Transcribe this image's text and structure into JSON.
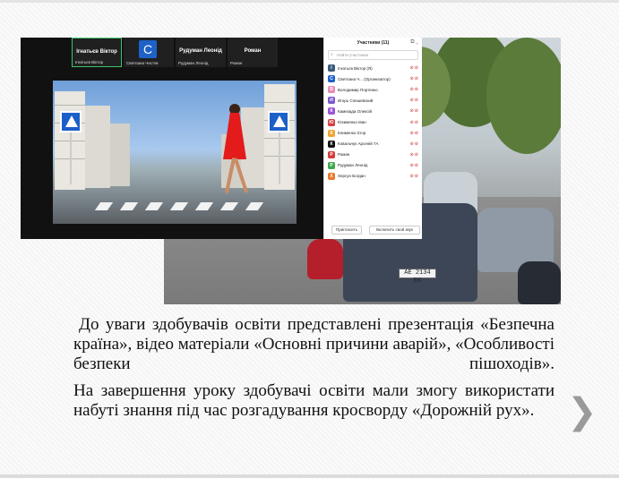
{
  "zoom": {
    "tiles": [
      {
        "name": "Ігнатьєв Віктор",
        "sub": "Ігнатьєв Віктор",
        "active": true
      },
      {
        "avatar": "C",
        "sub": "Светлана Чистяк"
      },
      {
        "name": "Рудуман Леонід",
        "sub": "Рудуман Леонід"
      },
      {
        "name": "Роман",
        "sub": "Роман"
      }
    ]
  },
  "participants": {
    "title": "Участники (11)",
    "search_placeholder": "Найти участника",
    "rows": [
      {
        "initial": "I",
        "color": "#3a5a7a",
        "name": "Ігнатьєв Віктор (Я)"
      },
      {
        "initial": "C",
        "color": "#1e62c8",
        "name": "Светлана Ч... (Организатор)"
      },
      {
        "initial": "В",
        "color": "#e98bb5",
        "name": "Володимир Портенко"
      },
      {
        "initial": "И",
        "color": "#7a56c9",
        "name": "Игорь Спешевский"
      },
      {
        "initial": "К",
        "color": "#9b55d8",
        "name": "Камизада Олексій"
      },
      {
        "initial": "Ю",
        "color": "#d63c3c",
        "name": "Юхименко Іван"
      },
      {
        "initial": "К",
        "color": "#f0a431",
        "name": "Клименко Єгор"
      },
      {
        "initial": "К",
        "color": "#111111",
        "name": "Ковальчук Арсеній 7А"
      },
      {
        "initial": "Р",
        "color": "#d63c3c",
        "name": "Роман"
      },
      {
        "initial": "Р",
        "color": "#3fa84b",
        "name": "Рудуман Леонід"
      },
      {
        "initial": "Х",
        "color": "#e8792a",
        "name": "Херсун Богдан"
      }
    ],
    "invite_label": "Пригласить",
    "unmute_label": "Включить свой звук"
  },
  "street": {
    "plate": "AE 2134 ЕК"
  },
  "body_text": {
    "paragraph1": "До уваги здобувачів освіти представлені презентація «Безпечна країна», відео матеріали «Основні причини аварій», «Особливості безпеки пішоходів».",
    "paragraph2": "На завершення уроку здобувачі освіти мали змогу використати набуті знання під час розгадування кросворду «Дорожній рух»."
  },
  "nav": {
    "next_icon": "chevron-right-icon",
    "next_glyph": "❯"
  }
}
